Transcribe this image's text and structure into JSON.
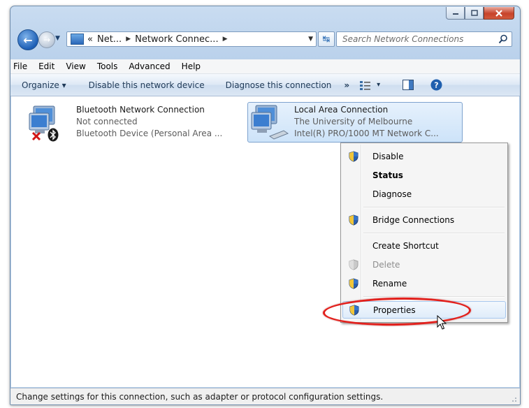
{
  "window": {
    "caption_buttons": [
      "minimize",
      "maximize",
      "close"
    ]
  },
  "nav": {
    "breadcrumb_prefix": "«",
    "breadcrumb": [
      "Net...",
      "Network Connec..."
    ],
    "search_placeholder": "Search Network Connections"
  },
  "menubar": [
    "File",
    "Edit",
    "View",
    "Tools",
    "Advanced",
    "Help"
  ],
  "toolbar": {
    "organize": "Organize ▾",
    "disable": "Disable this network device",
    "diagnose": "Diagnose this connection",
    "more": "»",
    "view_toggle": "▾"
  },
  "connections": [
    {
      "name": "Bluetooth Network Connection",
      "status": "Not connected",
      "device": "Bluetooth Device (Personal Area ..."
    },
    {
      "name": "Local Area Connection",
      "status": "The University of Melbourne",
      "device": "Intel(R) PRO/1000 MT Network C..."
    }
  ],
  "context_menu": {
    "items": [
      {
        "label": "Disable",
        "shield": true
      },
      {
        "label": "Status",
        "bold": true
      },
      {
        "label": "Diagnose"
      },
      {
        "label": "Bridge Connections",
        "shield": true
      },
      {
        "label": "Create Shortcut"
      },
      {
        "label": "Delete",
        "shield": true,
        "disabled": true
      },
      {
        "label": "Rename",
        "shield": true
      },
      {
        "label": "Properties",
        "shield": true,
        "highlighted": true
      }
    ]
  },
  "statusbar": {
    "text": "Change settings for this connection, such as adapter or protocol configuration settings."
  },
  "colors": {
    "accent": "#1d5fb6",
    "highlight_ring": "#e2201c",
    "selection": "#cde3f9"
  }
}
